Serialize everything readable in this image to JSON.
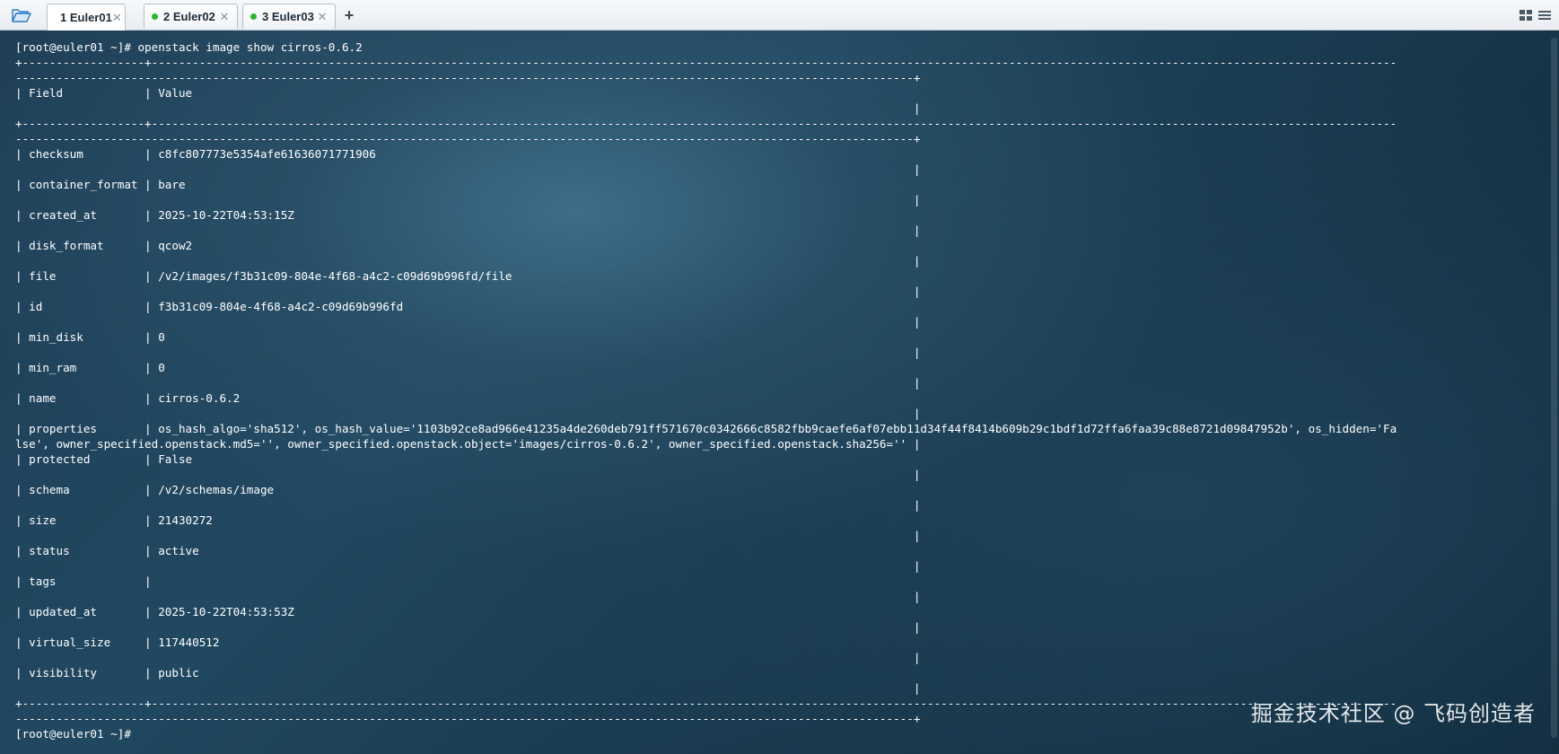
{
  "tabs": [
    {
      "label": "1 Euler01",
      "status_color": "#2bb52b",
      "active": true
    },
    {
      "label": "2 Euler02",
      "status_color": "#2bb52b",
      "active": false
    },
    {
      "label": "3 Euler03",
      "status_color": "#2bb52b",
      "active": false
    }
  ],
  "toolbar": {
    "open_icon": "folder-open-icon",
    "add_icon": "plus-icon",
    "add_label": "+",
    "close_glyph": "✕",
    "right_icons": [
      "grid-layout-icon",
      "menu-icon"
    ]
  },
  "terminal": {
    "prompt_host": "[root@euler01 ~]#",
    "command": "openstack image show cirros-0.6.2",
    "header": {
      "field": "Field",
      "value": "Value"
    },
    "rows": [
      {
        "field": "checksum",
        "value": "c8fc807773e5354afe61636071771906"
      },
      {
        "field": "container_format",
        "value": "bare"
      },
      {
        "field": "created_at",
        "value": "2025-10-22T04:53:15Z"
      },
      {
        "field": "disk_format",
        "value": "qcow2"
      },
      {
        "field": "file",
        "value": "/v2/images/f3b31c09-804e-4f68-a4c2-c09d69b996fd/file"
      },
      {
        "field": "id",
        "value": "f3b31c09-804e-4f68-a4c2-c09d69b996fd"
      },
      {
        "field": "min_disk",
        "value": "0"
      },
      {
        "field": "min_ram",
        "value": "0"
      },
      {
        "field": "name",
        "value": "cirros-0.6.2"
      },
      {
        "field": "properties",
        "value": "os_hash_algo='sha512', os_hash_value='1103b92ce8ad966e41235a4de260deb791ff571670c0342666c8582fbb9caefe6af07ebb11d34f44f8414b609b29c1bdf1d72ffa6faa39c88e8721d09847952b', os_hidden='False', owner_specified.openstack.md5='', owner_specified.openstack.object='images/cirros-0.6.2', owner_specified.openstack.sha256=''"
      },
      {
        "field": "protected",
        "value": "False"
      },
      {
        "field": "schema",
        "value": "/v2/schemas/image"
      },
      {
        "field": "size",
        "value": "21430272"
      },
      {
        "field": "status",
        "value": "active"
      },
      {
        "field": "tags",
        "value": ""
      },
      {
        "field": "updated_at",
        "value": "2025-10-22T04:53:53Z"
      },
      {
        "field": "virtual_size",
        "value": "117440512"
      },
      {
        "field": "visibility",
        "value": "public"
      }
    ],
    "final_prompt": "[root@euler01 ~]#"
  },
  "watermark": "掘金技术社区 @ 飞码创造者"
}
